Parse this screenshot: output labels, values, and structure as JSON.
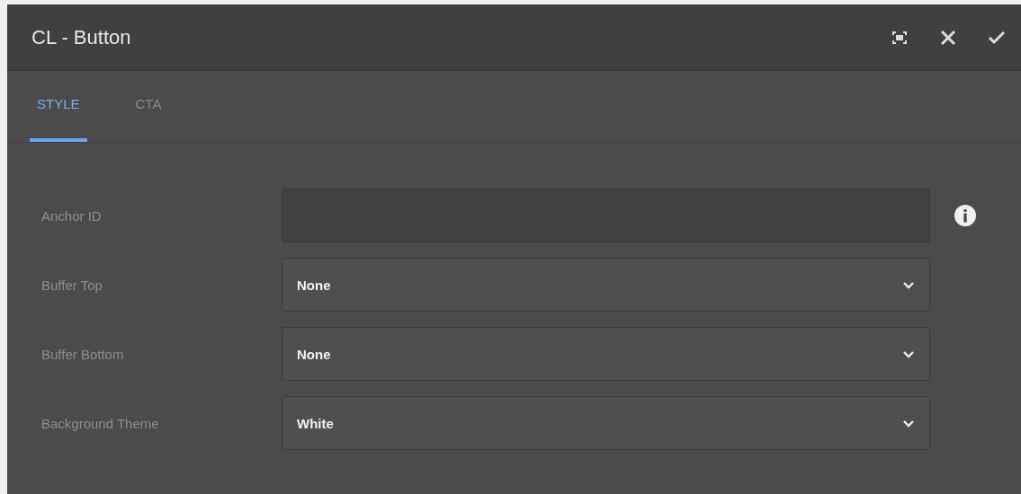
{
  "dialog": {
    "title": "CL - Button"
  },
  "tabs": [
    {
      "label": "STYLE",
      "selected": true
    },
    {
      "label": "CTA",
      "selected": false
    }
  ],
  "fields": [
    {
      "kind": "text",
      "label": "Anchor ID",
      "info": true
    },
    {
      "kind": "select",
      "label": "Buffer Top",
      "value": "None"
    },
    {
      "kind": "select",
      "label": "Buffer Bottom",
      "value": "None"
    },
    {
      "kind": "select",
      "label": "Background Theme",
      "value": "White"
    }
  ]
}
